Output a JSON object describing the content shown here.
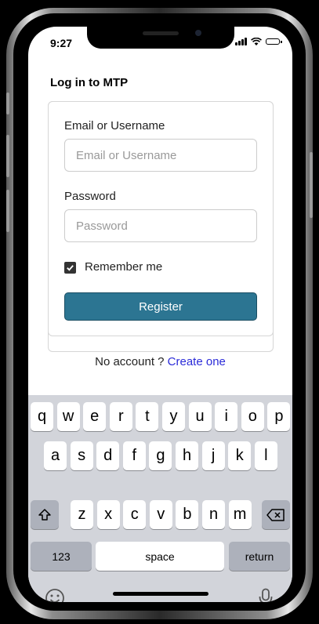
{
  "status_bar": {
    "time": "9:27"
  },
  "page": {
    "title": "Log in to MTP"
  },
  "form": {
    "username_label": "Email or Username",
    "username_placeholder": "Email or Username",
    "password_label": "Password",
    "password_placeholder": "Password",
    "remember_label": "Remember me",
    "remember_checked": true,
    "submit_label": "Register"
  },
  "footer": {
    "no_account_text": "No account ?",
    "create_link": "Create one"
  },
  "keyboard": {
    "row1": [
      "q",
      "w",
      "e",
      "r",
      "t",
      "y",
      "u",
      "i",
      "o",
      "p"
    ],
    "row2": [
      "a",
      "s",
      "d",
      "f",
      "g",
      "h",
      "j",
      "k",
      "l"
    ],
    "row3": [
      "z",
      "x",
      "c",
      "v",
      "b",
      "n",
      "m"
    ],
    "numbers_label": "123",
    "space_label": "space",
    "return_label": "return",
    "shift_icon": "shift-icon",
    "delete_icon": "delete-icon",
    "emoji_icon": "emoji-icon",
    "mic_icon": "microphone-icon"
  },
  "colors": {
    "primary_button": "#2c7592",
    "link": "#2b2bd8",
    "keyboard_bg": "#d2d4da"
  }
}
